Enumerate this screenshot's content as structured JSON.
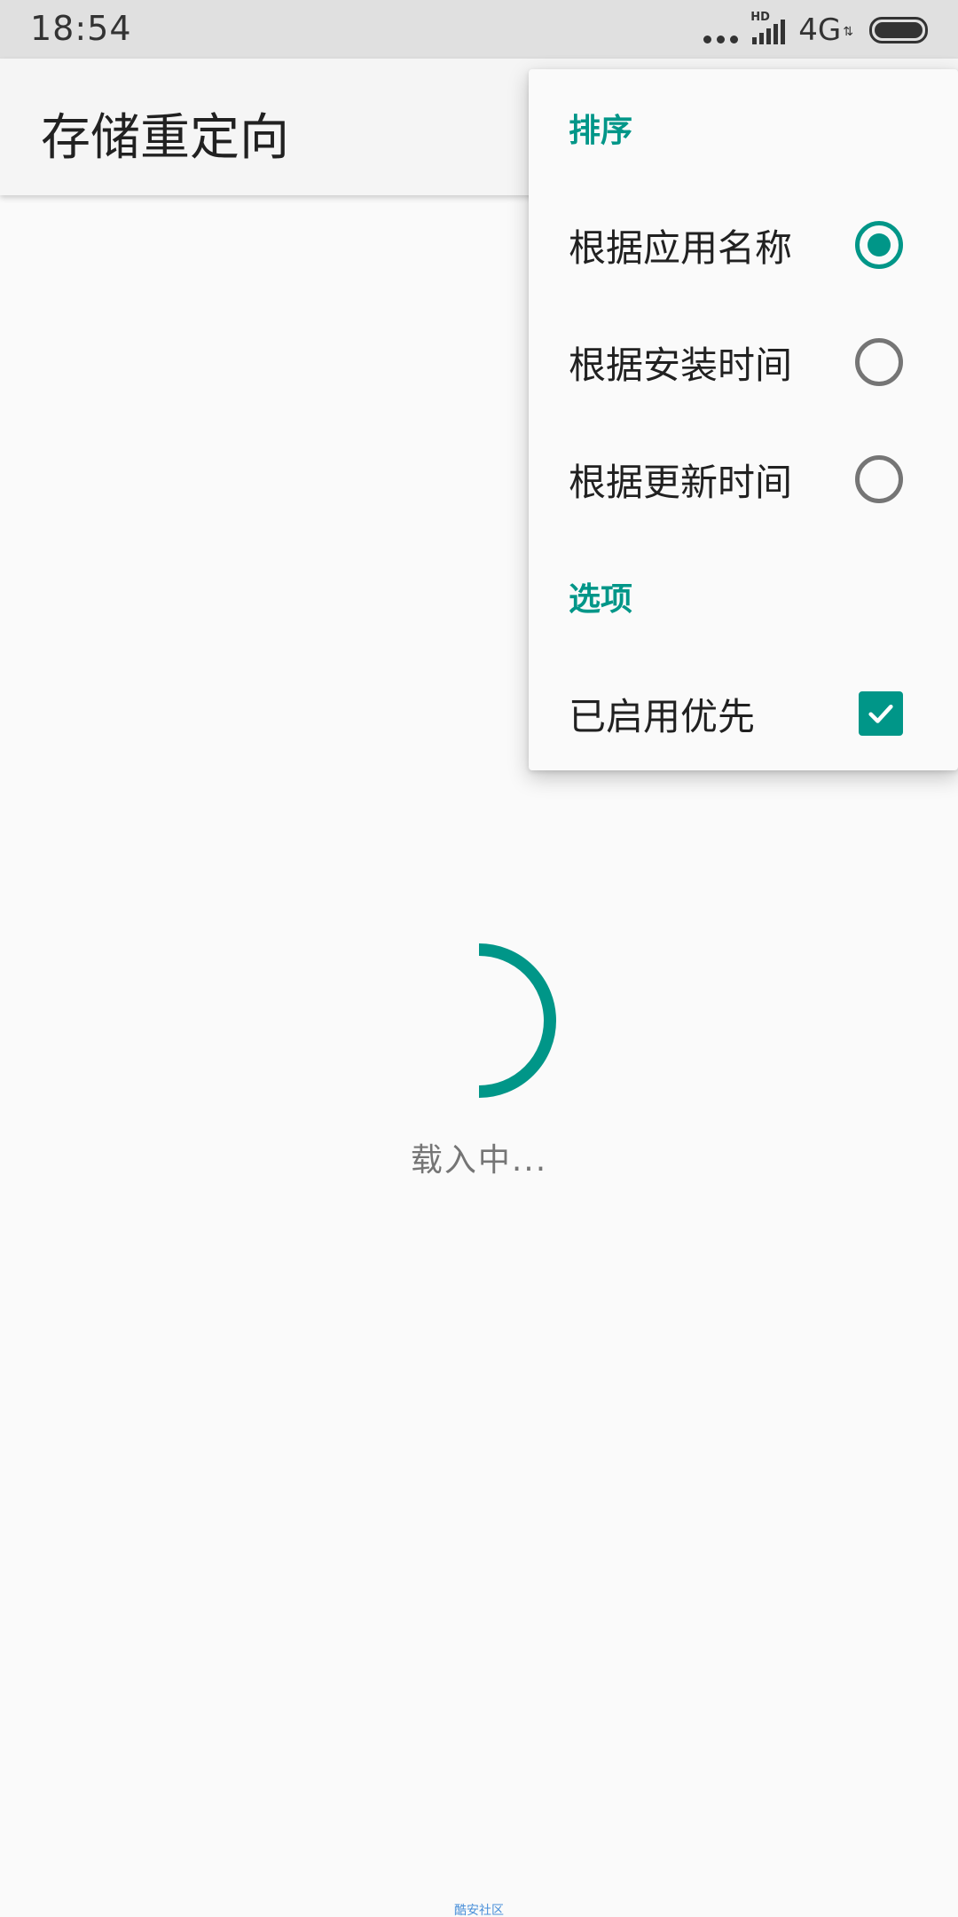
{
  "status_bar": {
    "time": "18:54",
    "network_type": "4G",
    "network_badge": "HD",
    "icons": [
      "more-dots-icon",
      "signal-icon",
      "battery-icon"
    ]
  },
  "app_bar": {
    "title": "存储重定向"
  },
  "menu": {
    "sort_header": "排序",
    "sort_options": [
      {
        "label": "根据应用名称",
        "selected": true
      },
      {
        "label": "根据安装时间",
        "selected": false
      },
      {
        "label": "根据更新时间",
        "selected": false
      }
    ],
    "options_header": "选项",
    "options": [
      {
        "label": "已启用优先",
        "checked": true
      }
    ]
  },
  "loading": {
    "text": "载入中..."
  },
  "watermark": {
    "text": "酷安社区"
  },
  "colors": {
    "accent": "#009688",
    "text_primary": "#212121",
    "text_secondary": "#757575",
    "background": "#fafafa"
  }
}
